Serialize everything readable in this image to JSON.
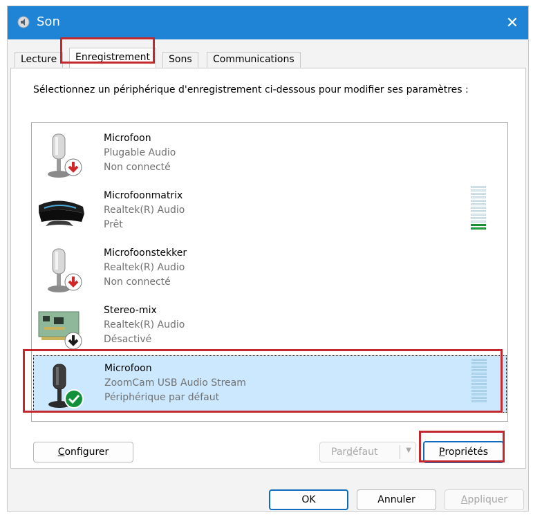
{
  "window": {
    "title": "Son",
    "icon": "speaker-icon",
    "close_label": "✕"
  },
  "tabs": [
    {
      "label": "Lecture"
    },
    {
      "label": "Enregistrement",
      "active": true
    },
    {
      "label": "Sons"
    },
    {
      "label": "Communications"
    }
  ],
  "instruction": "Sélectionnez un périphérique d'enregistrement ci-dessous pour modifier ses paramètres :",
  "devices": [
    {
      "name": "Microfoon",
      "driver": "Plugable Audio",
      "status": "Non connecté",
      "icon": "microphone-icon",
      "badge": "disconnected-arrow-icon",
      "level": null
    },
    {
      "name": "Microfoonmatrix",
      "driver": "Realtek(R) Audio",
      "status": "Prêt",
      "icon": "microphone-array-icon",
      "badge": null,
      "level": 0.15
    },
    {
      "name": "Microfoonstekker",
      "driver": "Realtek(R) Audio",
      "status": "Non connecté",
      "icon": "microphone-icon",
      "badge": "disconnected-arrow-icon",
      "level": null
    },
    {
      "name": "Stereo-mix",
      "driver": "Realtek(R) Audio",
      "status": "Désactivé",
      "icon": "sound-card-icon",
      "badge": "disabled-arrow-icon",
      "level": null
    },
    {
      "name": "Microfoon",
      "driver": "ZoomCam USB Audio Stream",
      "status": "Périphérique par défaut",
      "icon": "microphone-icon",
      "badge": "default-check-icon",
      "level": 0,
      "selected": true
    }
  ],
  "buttons": {
    "configure": {
      "prefix": "",
      "accel": "C",
      "rest": "onfigurer"
    },
    "default": {
      "prefix": "Par ",
      "accel": "d",
      "rest": "éfaut"
    },
    "properties": {
      "prefix": "",
      "accel": "P",
      "rest": "ropriétés"
    },
    "ok": "OK",
    "cancel": "Annuler",
    "apply": {
      "prefix": "",
      "accel": "A",
      "rest": "ppliquer"
    }
  },
  "colors": {
    "titlebar": "#1f84d6",
    "highlight_box": "#c4282f",
    "selection": "#cce8ff",
    "level_on": "#1f9e3c"
  }
}
